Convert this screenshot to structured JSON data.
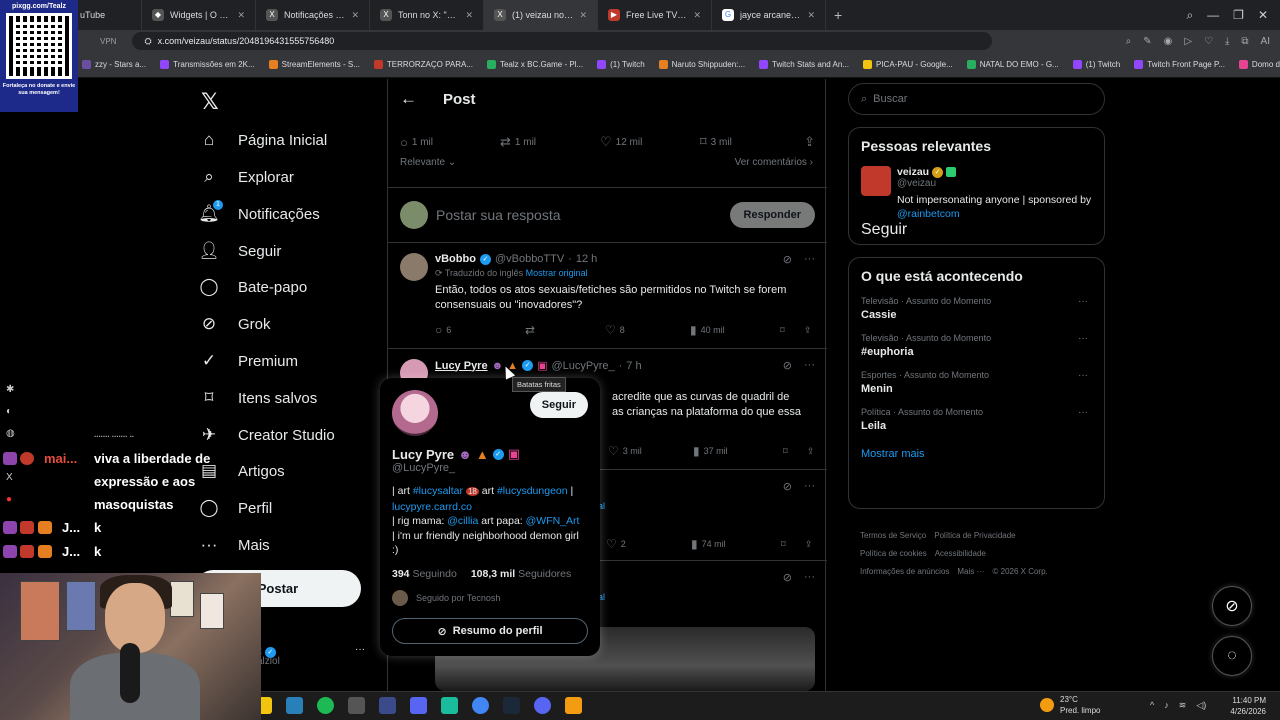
{
  "browser": {
    "tabs": [
      {
        "label": "uTube",
        "icon": "youtube-icon"
      },
      {
        "label": "Widgets | O melhor software",
        "icon": "widgets-icon"
      },
      {
        "label": "Notificações / X",
        "icon": "x-icon"
      },
      {
        "label": "Tonn no X: \"@rodrigofer",
        "icon": "x-icon"
      },
      {
        "label": "(1) veizau no X: \"Twitch",
        "icon": "x-icon",
        "active": true
      },
      {
        "label": "Free Live TV & Online R",
        "icon": "tv-icon"
      },
      {
        "label": "jayce arcane - Pesquisa",
        "icon": "google-icon"
      }
    ],
    "vpn": "VPN",
    "url": "x.com/veizau/status/2048196431555756480",
    "bookmarks": [
      "zzy - Stars a...",
      "Transmissões em 2K...",
      "StreamElements - S...",
      "TERRORZAÇO PARA...",
      "Tealz x BC.Game - Pl...",
      "(1) Twitch",
      "Naruto Shippuden:...",
      "Twitch Stats and An...",
      "PICA-PAU - Google...",
      "NATAL DO EMO - G...",
      "(1) Twitch",
      "Twitch Front Page P...",
      "Domo da Mata - Ho..."
    ]
  },
  "overlay": {
    "qr_label": "pixgg.com/Tealz",
    "qr_sub": "Fortaleça no donate e envie sua mensagem!",
    "chat": [
      {
        "user": "mai...",
        "text": "viva a liberdade de"
      },
      {
        "text": "expressão e aos"
      },
      {
        "text": "masoquistas"
      },
      {
        "user": "J...",
        "text": "k"
      },
      {
        "user": "J...",
        "text": "k"
      }
    ]
  },
  "nav": {
    "items": [
      {
        "label": "Página Inicial",
        "icon": "home-icon"
      },
      {
        "label": "Explorar",
        "icon": "search-icon"
      },
      {
        "label": "Notificações",
        "icon": "bell-icon",
        "badge": "1"
      },
      {
        "label": "Seguir",
        "icon": "follow-icon"
      },
      {
        "label": "Bate-papo",
        "icon": "chat-icon"
      },
      {
        "label": "Grok",
        "icon": "grok-icon"
      },
      {
        "label": "Premium",
        "icon": "premium-icon"
      },
      {
        "label": "Itens salvos",
        "icon": "bookmark-icon"
      },
      {
        "label": "Creator Studio",
        "icon": "rocket-icon"
      },
      {
        "label": "Artigos",
        "icon": "articles-icon"
      },
      {
        "label": "Perfil",
        "icon": "profile-icon"
      },
      {
        "label": "Mais",
        "icon": "more-icon"
      }
    ],
    "post_button": "Postar",
    "account_handle": "alzlol"
  },
  "main": {
    "title": "Post",
    "actions": {
      "replies": "1 mil",
      "reposts": "1 mil",
      "likes": "12 mil",
      "bookmarks": "3 mil"
    },
    "sort": "Relevante",
    "view_comments": "Ver comentários",
    "reply_placeholder": "Postar sua resposta",
    "reply_button": "Responder",
    "tweets": [
      {
        "name": "vBobbo",
        "handle": "@vBobboTTV",
        "time": "12 h",
        "translated": "Traduzido do inglês",
        "show_original": "Mostrar original",
        "text": "Então, todos os atos sexuais/fetiches são permitidos no Twitch se forem consensuais ou \"inovadores\"?",
        "replies": "6",
        "reposts": "",
        "likes": "8",
        "views": "40 mil"
      },
      {
        "name": "Lucy Pyre",
        "handle": "@LucyPyre_",
        "time": "7 h",
        "text_visible_1": "acredite que as curvas de quadril de",
        "text_visible_2": "as crianças na plataforma do que essa",
        "likes": "3 mil",
        "views": "37 mil"
      },
      {
        "replies": "",
        "likes": "2",
        "views": "74 mil"
      }
    ],
    "partial_link": "al"
  },
  "hovercard": {
    "follow": "Seguir",
    "name": "Lucy Pyre",
    "handle": "@LucyPyre_",
    "bio_line1_pre": "| art ",
    "bio_tag1": "#lucysaltar",
    "bio_18": "18",
    "bio_art": " art ",
    "bio_tag2": "#lucysdungeon",
    "bio_link": "lucypyre.carrd.co",
    "bio_rig_pre": "| rig mama: ",
    "bio_rig": "@cillia",
    "bio_papa_pre": " art papa: ",
    "bio_papa": "@WFN_Art",
    "bio_end": "|  i'm ur friendly neighborhood demon girl :)",
    "following_count": "394",
    "following_label": "Seguindo",
    "followers_count": "108,3 mil",
    "followers_label": "Seguidores",
    "followed_by": "Seguido por Tecnosh",
    "summary": "Resumo do perfil",
    "tooltip": "Batatas fritas"
  },
  "right": {
    "search_placeholder": "Buscar",
    "relevant_title": "Pessoas relevantes",
    "relevant": {
      "name": "veizau",
      "handle": "@veizau",
      "bio": "Not impersonating anyone | sponsored by ",
      "bio_link": "@rainbetcom",
      "follow": "Seguir"
    },
    "trending_title": "O que está acontecendo",
    "trends": [
      {
        "cat": "Televisão · Assunto do Momento",
        "topic": "Cassie"
      },
      {
        "cat": "Televisão · Assunto do Momento",
        "topic": "#euphoria"
      },
      {
        "cat": "Esportes · Assunto do Momento",
        "topic": "Menin"
      },
      {
        "cat": "Política · Assunto do Momento",
        "topic": "Leila"
      }
    ],
    "show_more": "Mostrar mais",
    "footer": [
      "Termos de Serviço",
      "Política de Privacidade",
      "Política de cookies",
      "Acessibilidade",
      "Informações de anúncios",
      "Mais ···",
      "© 2026 X Corp."
    ]
  },
  "taskbar": {
    "temp": "23°C",
    "weather": "Pred. limpo",
    "time": "11:40 PM",
    "date": "4/26/2026"
  }
}
